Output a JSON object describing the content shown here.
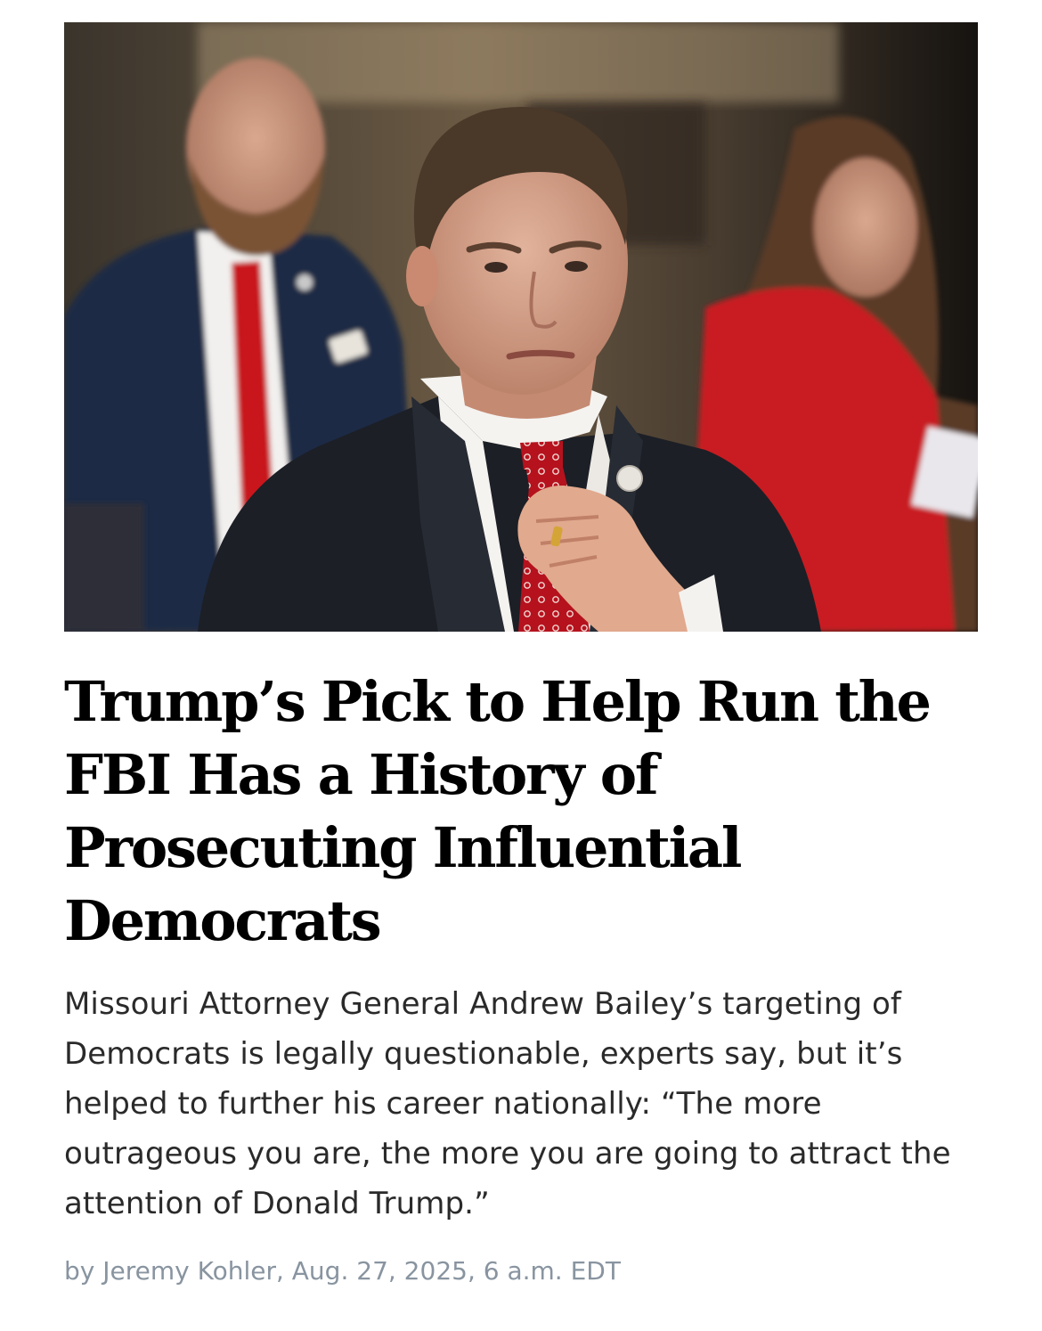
{
  "article": {
    "image_alt": "Missouri Attorney General Andrew Bailey adjusting his red tie while seated at a hearing",
    "headline": "Trump’s Pick to Help Run the FBI Has a History of Prosecuting Influential Democrats",
    "dek": "Missouri Attorney General Andrew Bailey’s targeting of Democrats is legally questionable, experts say, but it’s helped to further his career nationally: “The more outrageous you are, the more you are going to attract the attention of Donald Trump.”",
    "byline": {
      "prefix": "by",
      "author": "Jeremy Kohler",
      "separator": ",",
      "date": "Aug. 27, 2025, 6 a.m. EDT"
    }
  },
  "colors": {
    "headline": "#000000",
    "dek": "#2a2a2a",
    "byline": "#8894a0",
    "background": "#ffffff"
  }
}
